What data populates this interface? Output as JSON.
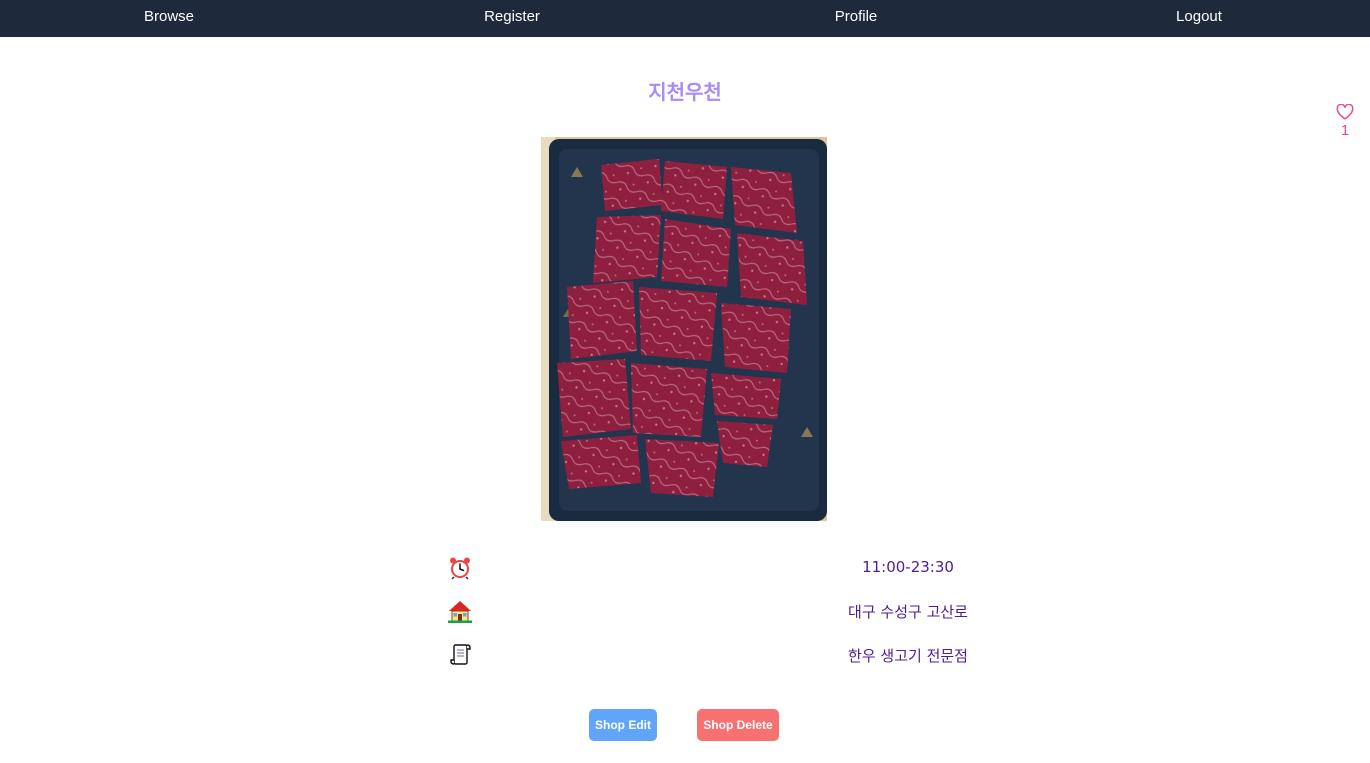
{
  "nav": {
    "browse": "Browse",
    "register": "Register",
    "profile": "Profile",
    "logout": "Logout"
  },
  "shop": {
    "name": "지천우천",
    "likes": "1",
    "hours": "11:00-23:30",
    "address": "대구 수성구 고산로",
    "description": "한우 생고기 전문점"
  },
  "icons": {
    "like": "heart-icon",
    "hours": "alarm-clock-icon",
    "address": "house-icon",
    "description": "scroll-icon"
  },
  "buttons": {
    "edit": "Shop Edit",
    "delete": "Shop Delete"
  },
  "colors": {
    "navbar": "#1e293b",
    "title": "#a78bfa",
    "info_text": "#4c1d95",
    "like": "#ec4899",
    "edit_button": "#60a5fa",
    "delete_button": "#f87171"
  }
}
